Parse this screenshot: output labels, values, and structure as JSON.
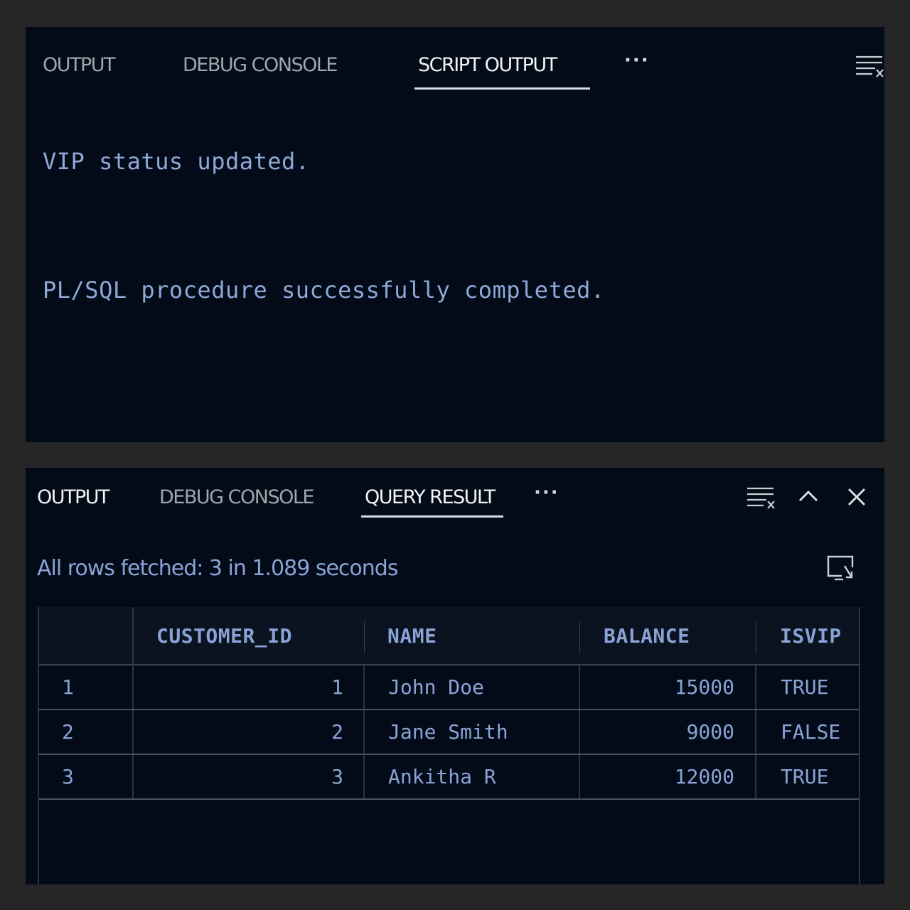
{
  "top_panel": {
    "tabs": [
      {
        "label": "OUTPUT"
      },
      {
        "label": "DEBUG CONSOLE"
      },
      {
        "label": "SCRIPT OUTPUT"
      }
    ],
    "more_label": "···",
    "lines": [
      "VIP status updated.",
      "PL/SQL procedure successfully completed."
    ],
    "icons": [
      "clear-output-icon"
    ]
  },
  "bottom_panel": {
    "tabs": [
      {
        "label": "OUTPUT"
      },
      {
        "label": "DEBUG CONSOLE"
      },
      {
        "label": "QUERY RESULT"
      }
    ],
    "more_label": "···",
    "icons": [
      "clear-output-icon",
      "chevron-up-icon",
      "close-icon",
      "export-icon"
    ],
    "status_text": "All rows fetched: 3 in 1.089 seconds",
    "table": {
      "columns": [
        "",
        "CUSTOMER_ID",
        "NAME",
        "BALANCE",
        "ISVIP"
      ],
      "rows": [
        [
          "1",
          "1",
          "John Doe",
          "15000",
          "TRUE"
        ],
        [
          "2",
          "2",
          "Jane Smith",
          "9000",
          "FALSE"
        ],
        [
          "3",
          "3",
          "Ankitha R",
          "12000",
          "TRUE"
        ]
      ]
    }
  }
}
